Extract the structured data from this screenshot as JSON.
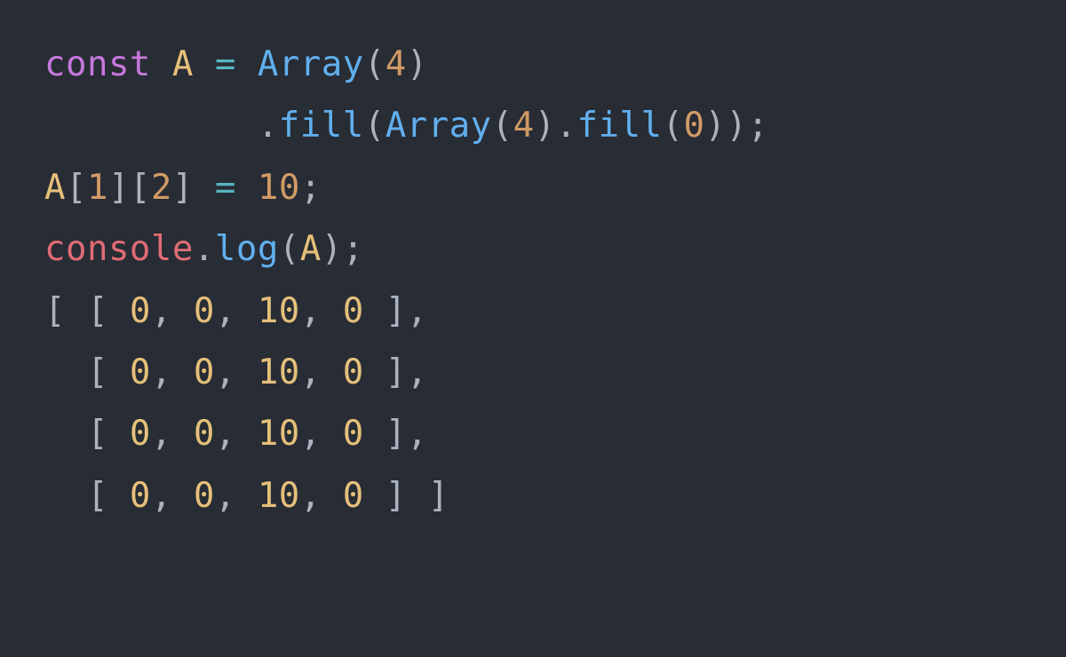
{
  "colors": {
    "background": "#282c34",
    "keyword": "#c678dd",
    "identifier": "#e5c07b",
    "operator": "#56b6c2",
    "function": "#61afef",
    "number": "#d19a66",
    "punctuation": "#abb2bf",
    "object": "#e06c75"
  },
  "code": {
    "lines": [
      [
        {
          "cls": "kw",
          "t": "const"
        },
        {
          "cls": "pn",
          "t": " "
        },
        {
          "cls": "varA",
          "t": "A"
        },
        {
          "cls": "pn",
          "t": " "
        },
        {
          "cls": "op",
          "t": "="
        },
        {
          "cls": "pn",
          "t": " "
        },
        {
          "cls": "fn",
          "t": "Array"
        },
        {
          "cls": "pn",
          "t": "("
        },
        {
          "cls": "num",
          "t": "4"
        },
        {
          "cls": "pn",
          "t": ")"
        }
      ],
      [
        {
          "cls": "pn",
          "t": "          ."
        },
        {
          "cls": "fn",
          "t": "fill"
        },
        {
          "cls": "pn",
          "t": "("
        },
        {
          "cls": "fn",
          "t": "Array"
        },
        {
          "cls": "pn",
          "t": "("
        },
        {
          "cls": "num",
          "t": "4"
        },
        {
          "cls": "pn",
          "t": ")."
        },
        {
          "cls": "fn",
          "t": "fill"
        },
        {
          "cls": "pn",
          "t": "("
        },
        {
          "cls": "num",
          "t": "0"
        },
        {
          "cls": "pn",
          "t": "));"
        }
      ],
      [
        {
          "cls": "varA",
          "t": "A"
        },
        {
          "cls": "pn",
          "t": "["
        },
        {
          "cls": "num",
          "t": "1"
        },
        {
          "cls": "pn",
          "t": "]["
        },
        {
          "cls": "num",
          "t": "2"
        },
        {
          "cls": "pn",
          "t": "] "
        },
        {
          "cls": "op",
          "t": "="
        },
        {
          "cls": "pn",
          "t": " "
        },
        {
          "cls": "num",
          "t": "10"
        },
        {
          "cls": "pn",
          "t": ";"
        }
      ],
      [
        {
          "cls": "obj",
          "t": "console"
        },
        {
          "cls": "pn",
          "t": "."
        },
        {
          "cls": "fn",
          "t": "log"
        },
        {
          "cls": "pn",
          "t": "("
        },
        {
          "cls": "varA",
          "t": "A"
        },
        {
          "cls": "pn",
          "t": ");"
        }
      ],
      [
        {
          "cls": "outb",
          "t": "[ [ "
        },
        {
          "cls": "outn",
          "t": "0"
        },
        {
          "cls": "outb",
          "t": ", "
        },
        {
          "cls": "outn",
          "t": "0"
        },
        {
          "cls": "outb",
          "t": ", "
        },
        {
          "cls": "outn",
          "t": "10"
        },
        {
          "cls": "outb",
          "t": ", "
        },
        {
          "cls": "outn",
          "t": "0"
        },
        {
          "cls": "outb",
          "t": " ],"
        }
      ],
      [
        {
          "cls": "outb",
          "t": "  [ "
        },
        {
          "cls": "outn",
          "t": "0"
        },
        {
          "cls": "outb",
          "t": ", "
        },
        {
          "cls": "outn",
          "t": "0"
        },
        {
          "cls": "outb",
          "t": ", "
        },
        {
          "cls": "outn",
          "t": "10"
        },
        {
          "cls": "outb",
          "t": ", "
        },
        {
          "cls": "outn",
          "t": "0"
        },
        {
          "cls": "outb",
          "t": " ],"
        }
      ],
      [
        {
          "cls": "outb",
          "t": "  [ "
        },
        {
          "cls": "outn",
          "t": "0"
        },
        {
          "cls": "outb",
          "t": ", "
        },
        {
          "cls": "outn",
          "t": "0"
        },
        {
          "cls": "outb",
          "t": ", "
        },
        {
          "cls": "outn",
          "t": "10"
        },
        {
          "cls": "outb",
          "t": ", "
        },
        {
          "cls": "outn",
          "t": "0"
        },
        {
          "cls": "outb",
          "t": " ],"
        }
      ],
      [
        {
          "cls": "outb",
          "t": "  [ "
        },
        {
          "cls": "outn",
          "t": "0"
        },
        {
          "cls": "outb",
          "t": ", "
        },
        {
          "cls": "outn",
          "t": "0"
        },
        {
          "cls": "outb",
          "t": ", "
        },
        {
          "cls": "outn",
          "t": "10"
        },
        {
          "cls": "outb",
          "t": ", "
        },
        {
          "cls": "outn",
          "t": "0"
        },
        {
          "cls": "outb",
          "t": " ] ]"
        }
      ]
    ]
  }
}
